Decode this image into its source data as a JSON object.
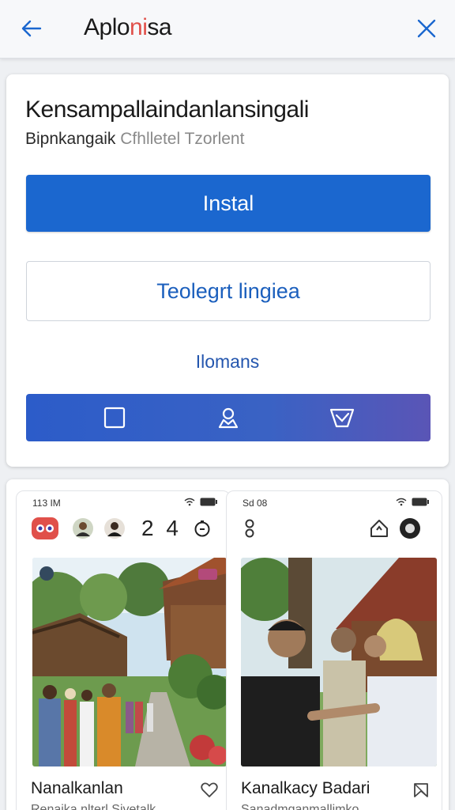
{
  "header": {
    "title_part1": "Aplo",
    "title_part2": "ni",
    "title_part3": "sa",
    "accent_color": "#e0504a",
    "icons": {
      "back": "arrow-left-icon",
      "close": "close-icon"
    }
  },
  "main_card": {
    "title": "Kensampallaindanlansingali",
    "subtitle_strong": "Bipnkangaik",
    "subtitle_muted": "Cfhlletel Tzorlent",
    "install_label": "Instal",
    "secondary_label": "Teolegrt lingiea",
    "link_label": "Ilomans",
    "action_bar_icons": [
      "square-icon",
      "user-icon",
      "message-icon"
    ],
    "brand_color": "#1b67cf"
  },
  "preview": {
    "left": {
      "time": "113 IM",
      "counter": "2 4",
      "caption_title": "Nanalkanlan",
      "caption_sub": "Renaika nlterl Sivetalk",
      "caption_icon": "heart-icon"
    },
    "right": {
      "time": "Sd 08",
      "caption_title": "Kanalkacy Badari",
      "caption_sub": "Sanadmganmallimko",
      "caption_icon": "bookmark-icon"
    }
  }
}
